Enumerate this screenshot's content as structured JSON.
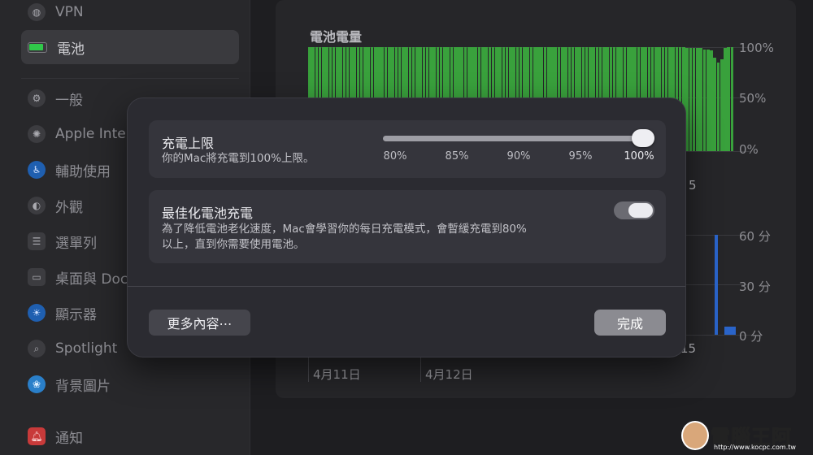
{
  "sidebar": {
    "items": [
      {
        "label": "VPN",
        "icon": "globe-icon"
      },
      {
        "label": "電池",
        "icon": "battery-icon",
        "active": true
      },
      {
        "label": "一般",
        "icon": "gear-icon"
      },
      {
        "label": "Apple Intel",
        "icon": "sparkle-icon"
      },
      {
        "label": "輔助使用",
        "icon": "accessibility-icon"
      },
      {
        "label": "外觀",
        "icon": "appearance-icon"
      },
      {
        "label": "選單列",
        "icon": "menubar-icon"
      },
      {
        "label": "桌面與 Doc",
        "icon": "desktop-icon"
      },
      {
        "label": "顯示器",
        "icon": "sun-icon"
      },
      {
        "label": "Spotlight",
        "icon": "search-icon"
      },
      {
        "label": "背景圖片",
        "icon": "wallpaper-icon"
      },
      {
        "label": "通知",
        "icon": "bell-icon"
      }
    ]
  },
  "chart": {
    "title": "電池電量",
    "y_top_labels": [
      "100%",
      "50%",
      "0%"
    ],
    "y_bottom_labels": [
      "60 分",
      "30 分",
      "0 分"
    ],
    "peek_label_a": "5",
    "peek_label_b": "15",
    "dates": [
      "4月11日",
      "4月12日"
    ]
  },
  "chart_data": [
    {
      "type": "bar",
      "title": "電池電量",
      "ylim": [
        0,
        100
      ],
      "y_unit": "%",
      "values": [
        100,
        100,
        100,
        100,
        100,
        100,
        100,
        100,
        100,
        100,
        100,
        100,
        100,
        100,
        100,
        100,
        100,
        100,
        100,
        100,
        100,
        100,
        100,
        100,
        100,
        100,
        100,
        100,
        100,
        100,
        100,
        100,
        100,
        100,
        100,
        100,
        100,
        100,
        100,
        100,
        100,
        100,
        100,
        100,
        100,
        100,
        100,
        100,
        100,
        100,
        100,
        100,
        100,
        100,
        100,
        100,
        100,
        100,
        100,
        100,
        100,
        100,
        100,
        100,
        100,
        100,
        100,
        100,
        100,
        100,
        100,
        100,
        100,
        100,
        100,
        100,
        100,
        100,
        100,
        100,
        100,
        100,
        100,
        100,
        100,
        100,
        100,
        100,
        100,
        100,
        100,
        100,
        100,
        100,
        100,
        100,
        100,
        100,
        100,
        100,
        100,
        100,
        100,
        100,
        100,
        100,
        100,
        100,
        100,
        99,
        99,
        99,
        99,
        99,
        98,
        98,
        97,
        90,
        85,
        88,
        99,
        100,
        100
      ],
      "grid": true
    },
    {
      "type": "bar",
      "ylim": [
        0,
        60
      ],
      "y_unit": "分",
      "values": [
        60,
        5
      ],
      "grid": true
    }
  ],
  "dialog": {
    "charge_limit": {
      "title": "充電上限",
      "description": "你的Mac將充電到100%上限。",
      "ticks": [
        "80%",
        "85%",
        "90%",
        "95%",
        "100%"
      ],
      "value": 100
    },
    "optimized": {
      "title": "最佳化電池充電",
      "description_line1": "為了降低電池老化速度，Mac會學習你的每日充電模式，會暫緩充電到80%",
      "description_line2": "以上，直到你需要使用電池。",
      "enabled": true
    },
    "more_label": "更多內容⋯",
    "done_label": "完成"
  },
  "watermark": {
    "text": "電腦王阿達",
    "url": "http://www.kocpc.com.tw"
  },
  "colors": {
    "battery_green": "#39a13c",
    "screen_time_blue": "#2a64c9",
    "dialog_bg": "#2b2b31"
  }
}
